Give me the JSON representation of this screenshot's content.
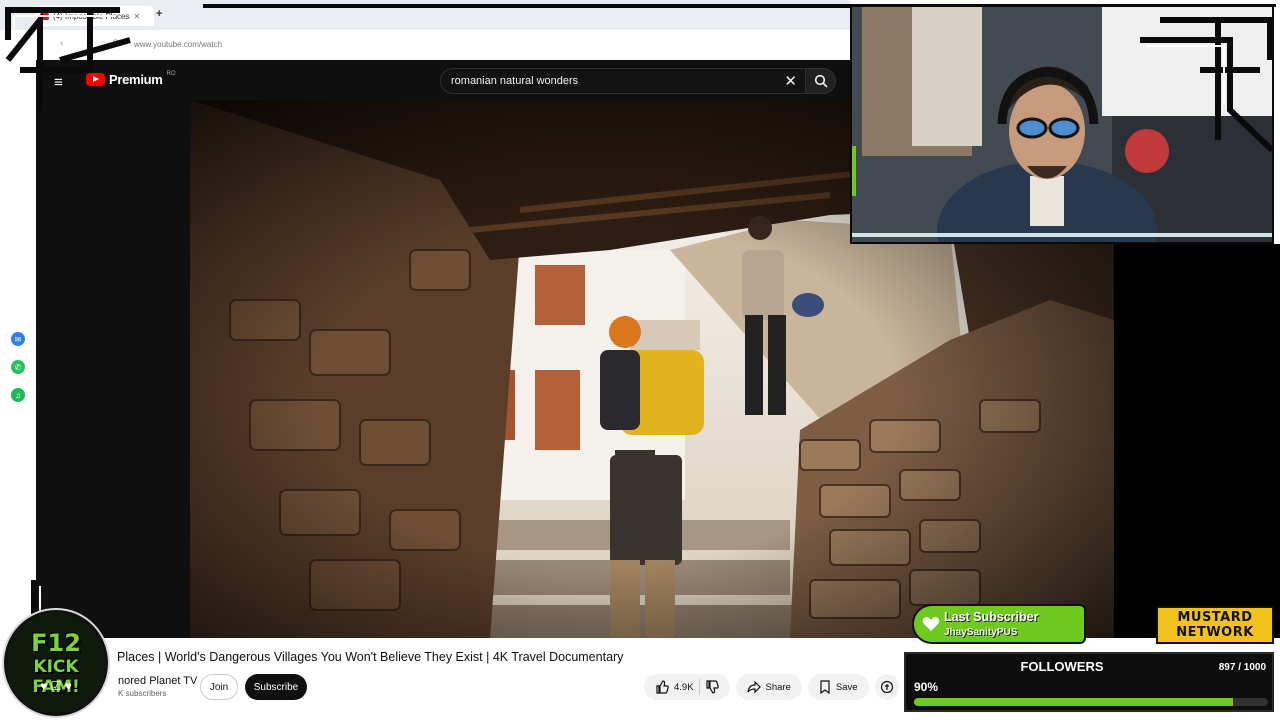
{
  "browser": {
    "tab_title": "(4) Impossible Places",
    "new_tab": "+",
    "url": "www.youtube.com/watch"
  },
  "youtube": {
    "brand": "Premium",
    "country": "RO",
    "search_query": "romanian natural wonders",
    "clear_label": "✕"
  },
  "video": {
    "title": "Places | World's Dangerous Villages You Won't Believe They Exist | 4K Travel Documentary",
    "channel": "nored Planet TV",
    "subscribers": "K subscribers",
    "join_label": "Join",
    "subscribe_label": "Subscribe",
    "likes": "4.9K",
    "share_label": "Share",
    "save_label": "Save"
  },
  "overlay": {
    "last_subscriber_title": "Last Subscriber",
    "last_subscriber_name": "JhaySanityPUS",
    "logo_line1": "MUSTARD",
    "logo_line2": "NETWORK",
    "followers_title": "FOLLOWERS",
    "followers_count": "897 / 1000",
    "followers_percent": "90%",
    "followers_progress": 0.9,
    "badge_line1": "F12",
    "badge_line2": "KICK FAM!",
    "badge_icons": "♥ ☑ ♥"
  },
  "colors": {
    "accent_green": "#6fca1f",
    "youtube_red": "#ff0000",
    "mustard": "#f2c21c"
  }
}
